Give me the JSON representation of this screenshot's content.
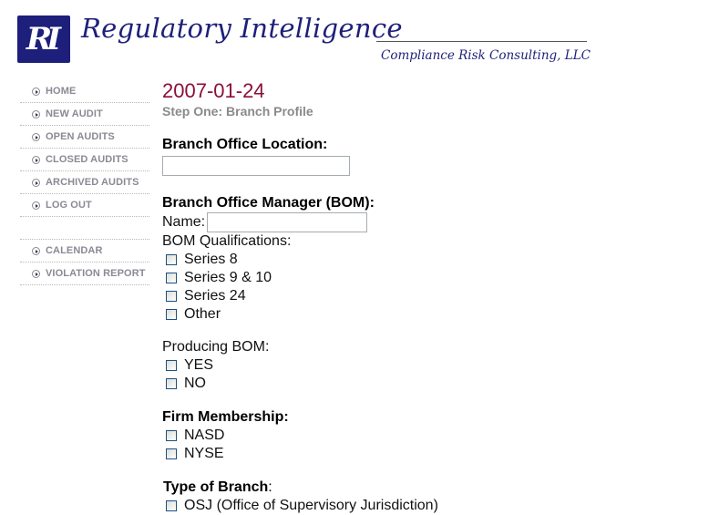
{
  "header": {
    "logo_initials": "RI",
    "brand_title": "Regulatory Intelligence",
    "brand_subtitle": "Compliance Risk Consulting, LLC",
    "brand_color": "#1d1f7a"
  },
  "sidebar": {
    "items": [
      {
        "label": "HOME",
        "icon": "circle-arrow-right-icon"
      },
      {
        "label": "NEW AUDIT",
        "icon": "circle-arrow-right-icon"
      },
      {
        "label": "OPEN AUDITS",
        "icon": "circle-arrow-right-icon"
      },
      {
        "label": "CLOSED AUDITS",
        "icon": "circle-arrow-right-icon"
      },
      {
        "label": "ARCHIVED AUDITS",
        "icon": "circle-arrow-right-icon"
      },
      {
        "label": "LOG OUT",
        "icon": "circle-arrow-right-icon"
      }
    ],
    "secondary_items": [
      {
        "label": "CALENDAR",
        "icon": "circle-arrow-right-icon"
      },
      {
        "label": "VIOLATION REPORT",
        "icon": "circle-arrow-right-icon"
      }
    ]
  },
  "main": {
    "date": "2007-01-24",
    "step_title": "Step One: Branch Profile",
    "branch_location": {
      "heading": "Branch Office Location:",
      "value": ""
    },
    "bom": {
      "heading": "Branch Office Manager (BOM):",
      "name_label": "Name:",
      "name_value": "",
      "qualifications_label": "BOM Qualifications:",
      "qualifications": [
        {
          "label": "Series 8",
          "checked": false
        },
        {
          "label": "Series 9 & 10",
          "checked": false
        },
        {
          "label": "Series 24",
          "checked": false
        },
        {
          "label": "Other",
          "checked": false
        }
      ]
    },
    "producing_bom": {
      "label": "Producing BOM:",
      "options": [
        {
          "label": "YES",
          "checked": false
        },
        {
          "label": "NO",
          "checked": false
        }
      ]
    },
    "firm_membership": {
      "heading": "Firm Membership:",
      "options": [
        {
          "label": "NASD",
          "checked": false
        },
        {
          "label": "NYSE",
          "checked": false
        }
      ]
    },
    "type_of_branch": {
      "heading": "Type of Branch",
      "colon": ":",
      "options": [
        {
          "label": "OSJ (Office of Supervisory Jurisdiction)",
          "checked": false
        }
      ]
    }
  }
}
